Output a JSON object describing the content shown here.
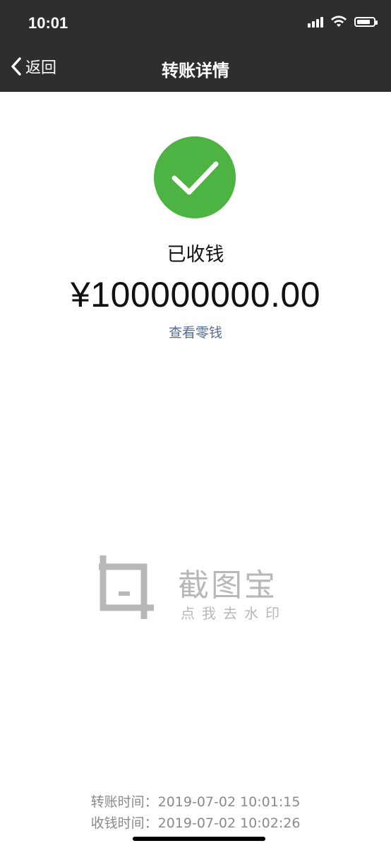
{
  "status_bar": {
    "time": "10:01"
  },
  "nav": {
    "back_label": "返回",
    "title": "转账详情"
  },
  "transfer": {
    "status": "已收钱",
    "amount": "¥100000000.00",
    "view_change_link": "查看零钱"
  },
  "watermark": {
    "title": "截图宝",
    "subtitle": "点我去水印",
    "icon": "crop-icon"
  },
  "times": [
    {
      "label": "转账时间：",
      "value": "2019-07-02 10:01:15"
    },
    {
      "label": "收钱时间：",
      "value": "2019-07-02 10:02:26"
    }
  ],
  "colors": {
    "nav_bg": "#2e2e2e",
    "success_green": "#4db342",
    "link_blue": "#576b95",
    "watermark_gray": "#b8b8b8"
  }
}
